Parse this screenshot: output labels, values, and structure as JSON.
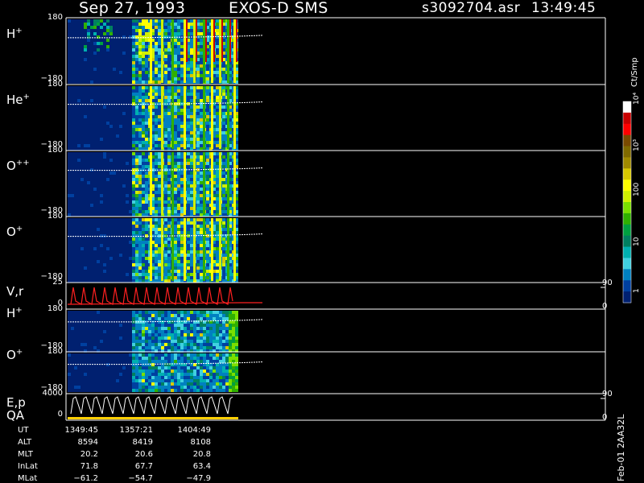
{
  "header": {
    "date": "Sep 27, 1993",
    "instrument": "EXOS-D SMS",
    "filename": "s3092704.asr",
    "time": "13:49:45"
  },
  "colorbar": {
    "unit": "Ct/Smp",
    "tick_labels": [
      "10⁴",
      "10³",
      "100",
      "10",
      "1"
    ],
    "colors": [
      "#ffffff",
      "#c80000",
      "#ff0000",
      "#7a4a00",
      "#806a00",
      "#a08a00",
      "#d8c800",
      "#ffff00",
      "#d0f000",
      "#7adf00",
      "#30b000",
      "#00a040",
      "#008060",
      "#00b0b0",
      "#40d0e0",
      "#0080c0",
      "#0040a0",
      "#002070"
    ]
  },
  "panels": [
    {
      "label": "H",
      "sup": "+",
      "top_tick": "180",
      "bottom_tick": "−180"
    },
    {
      "label": "He",
      "sup": "+",
      "top_tick": "180",
      "bottom_tick": "−180"
    },
    {
      "label": "O",
      "sup": "++",
      "top_tick": "180",
      "bottom_tick": "−180"
    },
    {
      "label": "O",
      "sup": "+",
      "top_tick": "180",
      "bottom_tick": "−180"
    },
    {
      "label": "V,r",
      "sup": "",
      "top_tick": "25",
      "bottom_tick": "0",
      "right_top": "90",
      "right_bottom": "0"
    },
    {
      "label": "H",
      "sup": "+",
      "top_tick": "180",
      "bottom_tick": "−180"
    },
    {
      "label": "O",
      "sup": "+",
      "top_tick": "180",
      "bottom_tick": "−180"
    },
    {
      "label": "E,p",
      "label2": "QA",
      "sup": "",
      "top_tick": "4000",
      "bottom_tick": "0",
      "right_top": "90",
      "right_bottom": "0"
    }
  ],
  "info_table": {
    "rows": [
      {
        "name": "UT",
        "values": [
          "1349:45",
          "1357:21",
          "1404:49"
        ]
      },
      {
        "name": "ALT",
        "values": [
          "8594",
          "8419",
          "8108"
        ]
      },
      {
        "name": "MLT",
        "values": [
          "20.2",
          "20.6",
          "20.8"
        ]
      },
      {
        "name": "InLat",
        "values": [
          "71.8",
          "67.7",
          "63.4"
        ]
      },
      {
        "name": "MLat",
        "values": [
          "−61.2",
          "−54.7",
          "−47.9"
        ]
      }
    ]
  },
  "footer_vertical": "Feb-01 2AA32L",
  "chart_data": {
    "type": "heatmap",
    "title": "Sep 27, 1993   EXOS-D SMS",
    "x_tick_labels": [
      "1349:45",
      "1357:21",
      "1404:49"
    ],
    "panels": [
      "H+",
      "He+",
      "O++",
      "O+",
      "V,r",
      "H+",
      "O+",
      "E,p QA"
    ],
    "y_range_angle": [
      -180,
      180
    ],
    "v_range": [
      0,
      25
    ],
    "e_range": [
      0,
      4000
    ],
    "colorbar_range": [
      1,
      10000
    ],
    "colorbar_scale": "log"
  }
}
